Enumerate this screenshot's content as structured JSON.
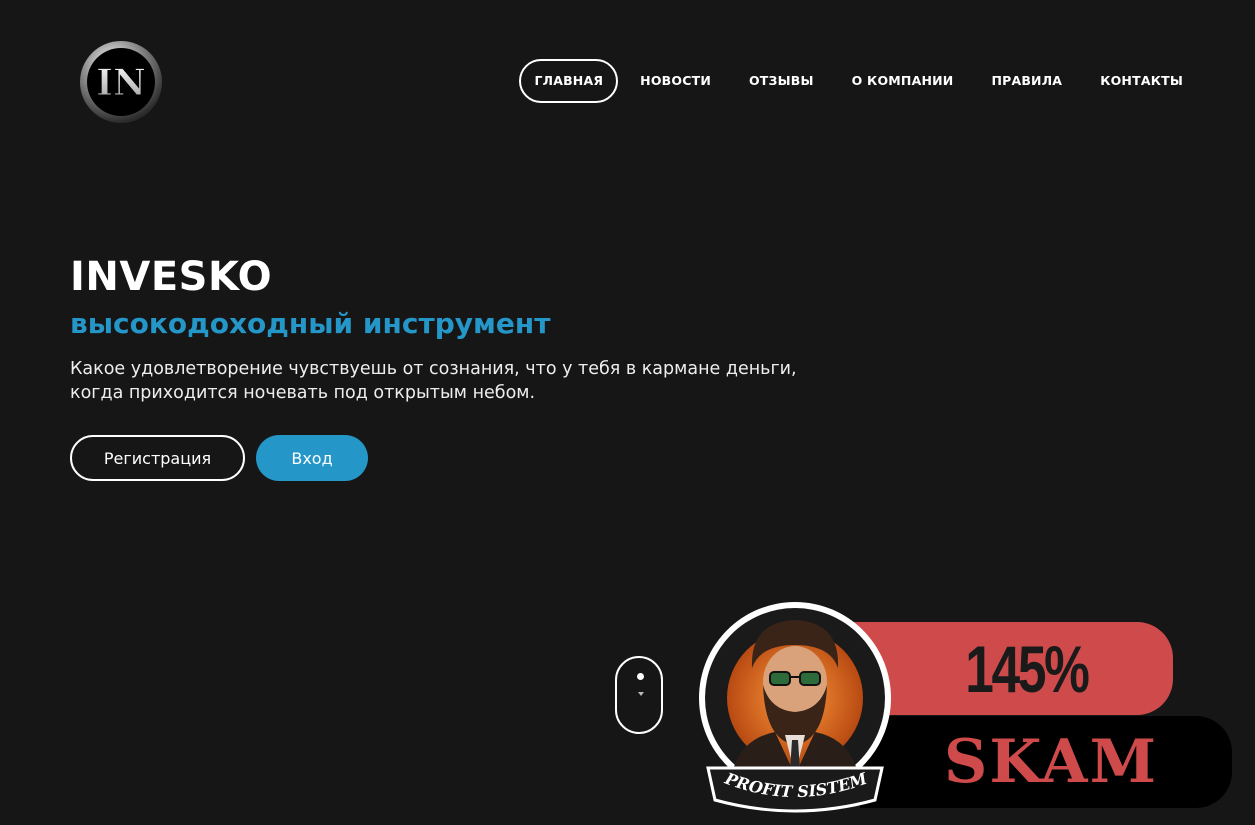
{
  "logo": {
    "text": "IN",
    "icon": "in-logo-icon"
  },
  "nav": {
    "items": [
      {
        "label": "ГЛАВНАЯ",
        "active": true
      },
      {
        "label": "НОВОСТИ",
        "active": false
      },
      {
        "label": "ОТЗЫВЫ",
        "active": false
      },
      {
        "label": "О КОМПАНИИ",
        "active": false
      },
      {
        "label": "ПРАВИЛА",
        "active": false
      },
      {
        "label": "КОНТАКТЫ",
        "active": false
      }
    ]
  },
  "hero": {
    "title": "INVESKO",
    "subtitle": "высокодоходный инструмент",
    "text_line1": "Какое удовлетворение чувствуешь от сознания, что у тебя в кармане деньги,",
    "text_line2": "когда приходится ночевать под открытым небом."
  },
  "buttons": {
    "register": "Регистрация",
    "login": "Вход"
  },
  "badge": {
    "percent": "145%",
    "label": "SKAM",
    "ribbon": "PROFIT SISTEM"
  },
  "colors": {
    "background": "#161616",
    "accent": "#2596c8",
    "badge_red": "#cf4b4b"
  }
}
